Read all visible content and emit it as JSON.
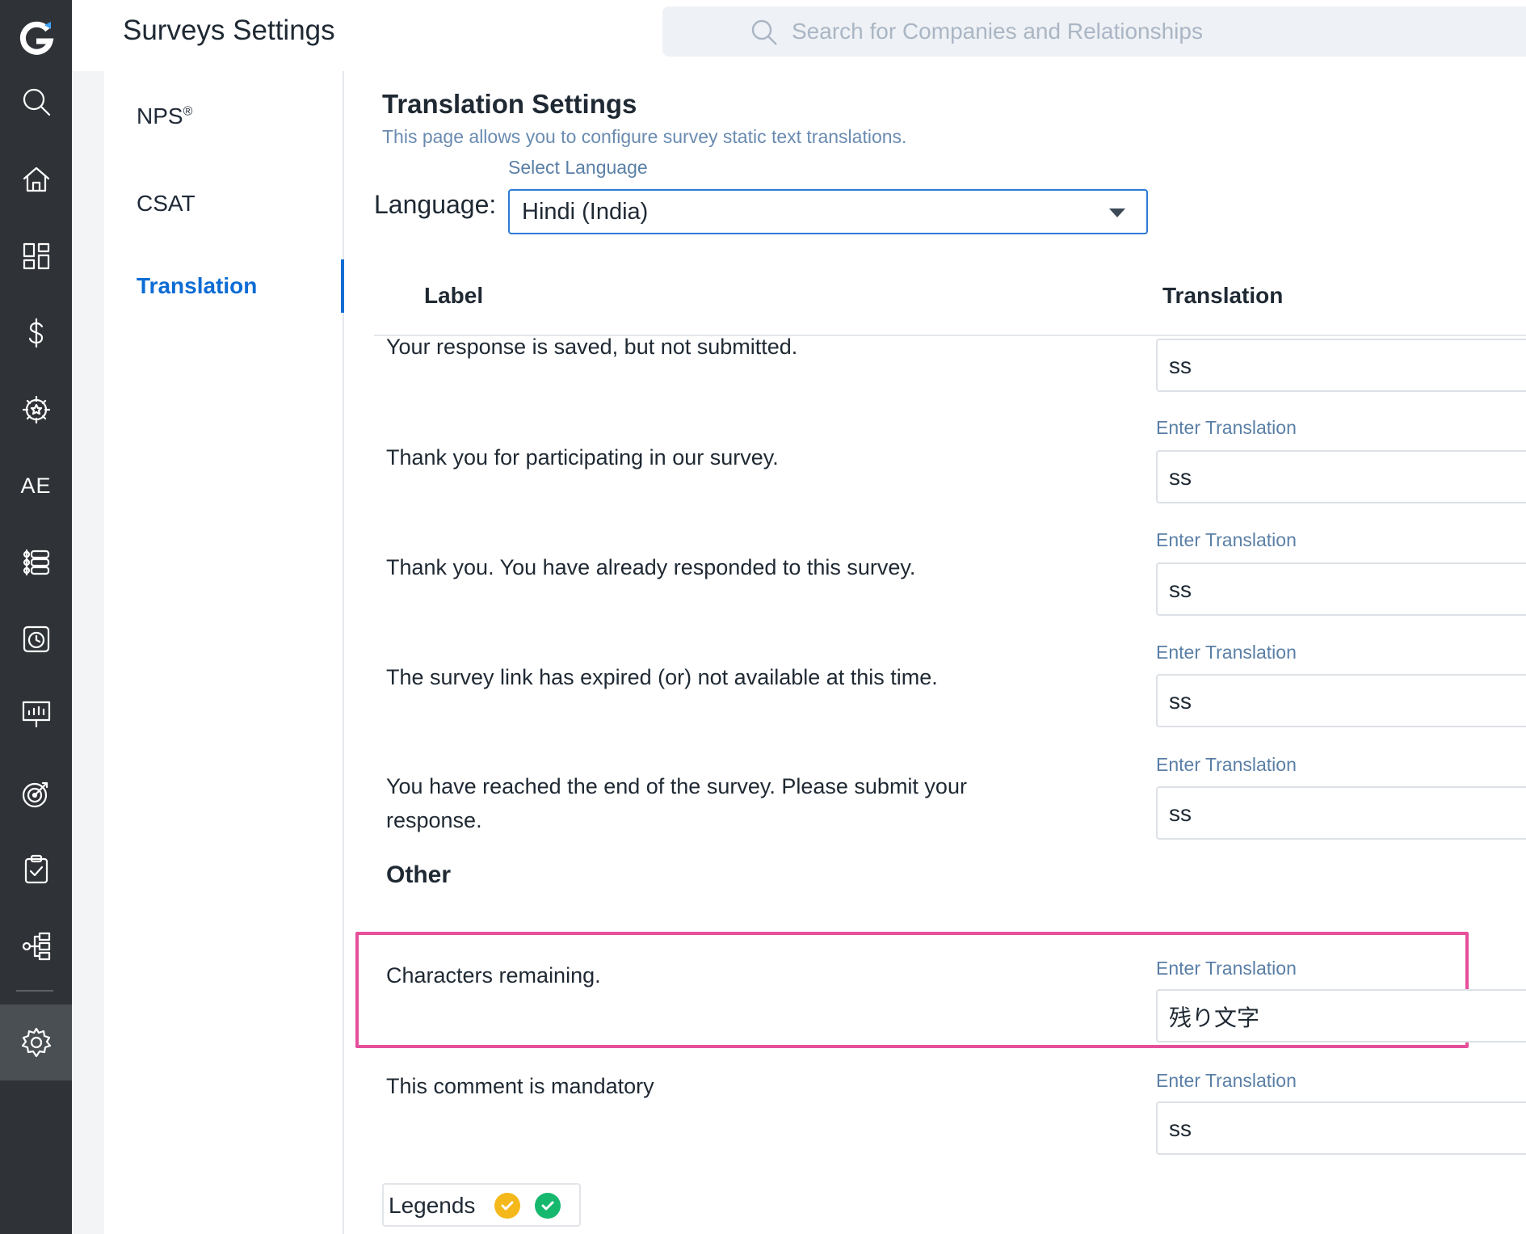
{
  "header": {
    "title": "Surveys Settings",
    "search_placeholder": "Search for Companies and Relationships"
  },
  "rail": {
    "logo": "G",
    "ae_label": "AE",
    "icons": [
      "search-icon",
      "home-icon",
      "dashboard-icon",
      "dollar-icon",
      "gear-star-icon",
      "ae-icon",
      "timeline-icon",
      "clock-icon",
      "report-icon",
      "target-icon",
      "clipboard-check-icon",
      "hierarchy-icon",
      "settings-icon"
    ]
  },
  "subnav": {
    "items": [
      {
        "label": "NPS",
        "sup": "®"
      },
      {
        "label": "CSAT"
      },
      {
        "label": "Translation"
      }
    ]
  },
  "main": {
    "title": "Translation Settings",
    "description": "This page allows you to configure survey static text translations.",
    "language_label": "Language:",
    "select_caption": "Select Language",
    "selected_language": "Hindi (India)",
    "columns": [
      "Label",
      "Translation"
    ],
    "field_caption": "Enter Translation",
    "rows": [
      {
        "label": "Your response is saved, but not submitted.",
        "value": "ss"
      },
      {
        "label": "Thank you for participating in our survey.",
        "value": "ss"
      },
      {
        "label": "Thank you. You have already responded to this survey.",
        "value": "ss"
      },
      {
        "label": "The survey link has expired (or) not available at this time.",
        "value": "ss"
      },
      {
        "label": "You have reached the end of the survey. Please submit your response.",
        "value": "ss"
      }
    ],
    "other_heading": "Other",
    "other_rows": [
      {
        "label": "Characters remaining.",
        "value": "残り文字"
      },
      {
        "label": "This comment is mandatory",
        "value": "ss"
      }
    ],
    "legends_label": "Legends",
    "legend_colors": {
      "yellow": "#f5b81b",
      "green": "#16b86e"
    }
  },
  "colors": {
    "rail_bg": "#2f3337",
    "accent": "#0c6cd4",
    "highlight": "#e64f9a"
  }
}
